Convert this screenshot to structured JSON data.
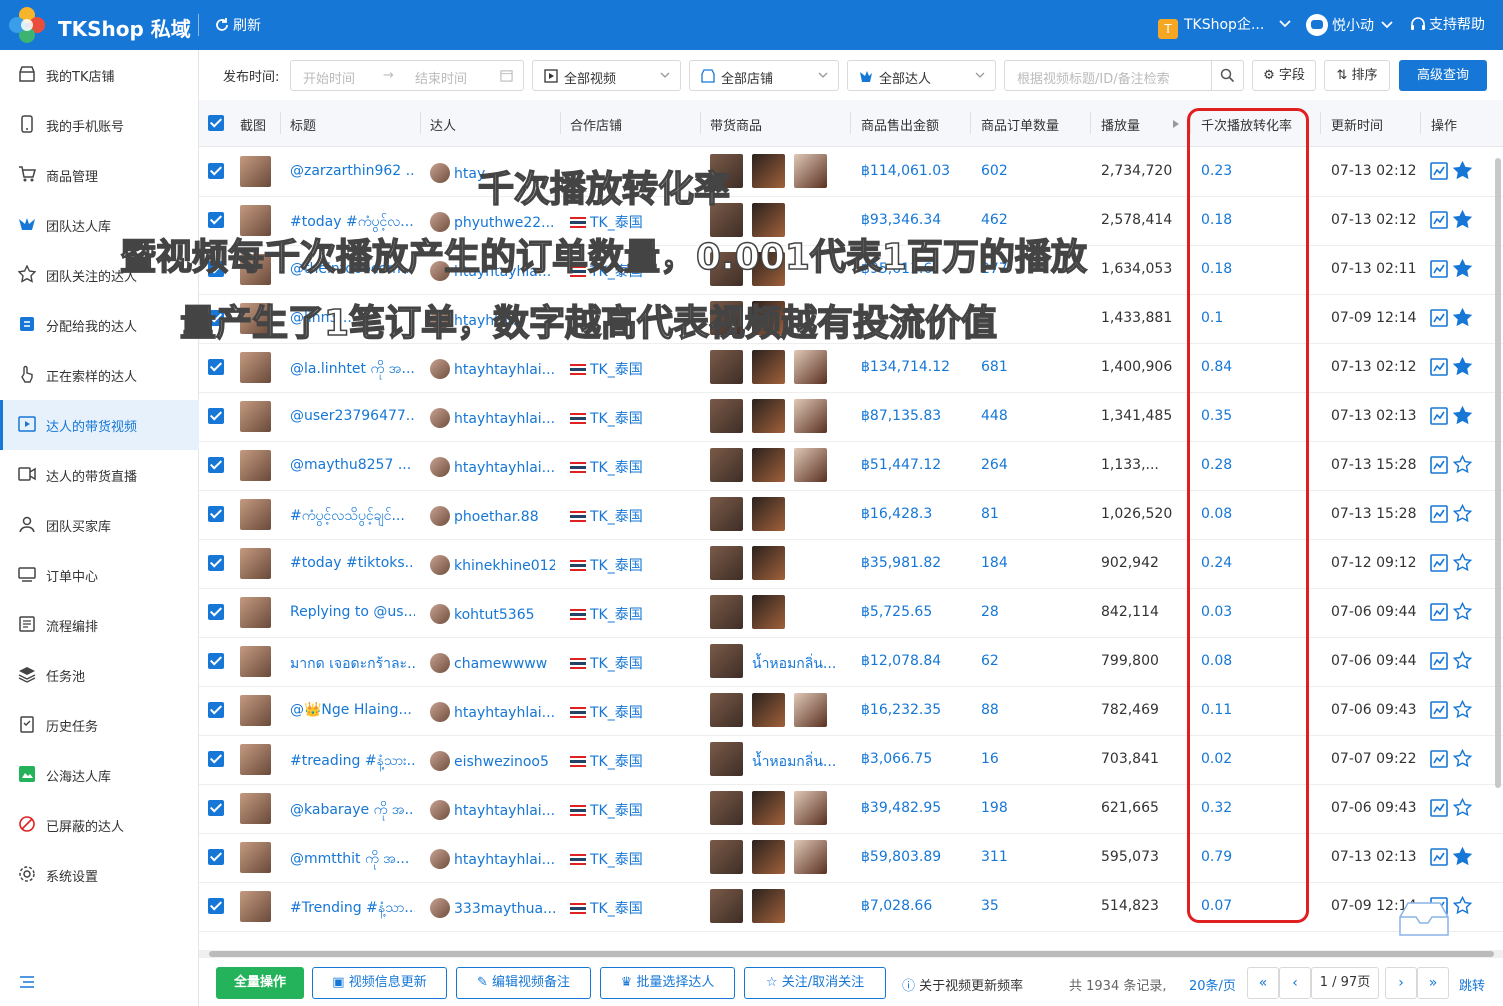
{
  "header": {
    "app_title": "TKShop 私域",
    "refresh": "刷新",
    "company": "TKShop企...",
    "company_badge": "T",
    "user": "悦小动",
    "help": "支持帮助"
  },
  "sidebar": {
    "items": [
      {
        "label": "我的TK店铺",
        "icon": "shop-icon"
      },
      {
        "label": "我的手机账号",
        "icon": "phone-icon"
      },
      {
        "label": "商品管理",
        "icon": "cart-icon"
      },
      {
        "label": "团队达人库",
        "icon": "creator-icon"
      },
      {
        "label": "团队关注的达人",
        "icon": "star-icon"
      },
      {
        "label": "分配给我的达人",
        "icon": "assign-icon"
      },
      {
        "label": "正在索样的达人",
        "icon": "hand-icon"
      },
      {
        "label": "达人的带货视频",
        "icon": "video-icon",
        "active": true
      },
      {
        "label": "达人的带货直播",
        "icon": "live-icon"
      },
      {
        "label": "团队买家库",
        "icon": "buyer-icon"
      },
      {
        "label": "订单中心",
        "icon": "order-icon"
      },
      {
        "label": "流程编排",
        "icon": "flow-icon"
      },
      {
        "label": "任务池",
        "icon": "layers-icon"
      },
      {
        "label": "历史任务",
        "icon": "history-icon"
      },
      {
        "label": "公海达人库",
        "icon": "pool-icon"
      },
      {
        "label": "已屏蔽的达人",
        "icon": "block-icon"
      },
      {
        "label": "系统设置",
        "icon": "gear-icon"
      }
    ]
  },
  "filters": {
    "publish_label": "发布时间:",
    "start_placeholder": "开始时间",
    "end_placeholder": "结束时间",
    "videos": "全部视频",
    "shops": "全部店铺",
    "creators": "全部达人",
    "search_placeholder": "根据视频标题/ID/备注检索",
    "fields": "字段",
    "sort": "排序",
    "advanced": "高级查询"
  },
  "table": {
    "headers": {
      "screenshot": "截图",
      "title": "标题",
      "creator": "达人",
      "shop": "合作店铺",
      "products": "带货商品",
      "gmv": "商品售出金额",
      "orders": "商品订单数量",
      "views": "播放量",
      "cpm_rate": "千次播放转化率",
      "updated": "更新时间",
      "actions": "操作"
    },
    "rows": [
      {
        "title": "@zarzarthin962 ...",
        "creator": "htay...",
        "shop": "",
        "products": [
          "p1",
          "p2",
          "p3"
        ],
        "gmv": "฿114,061.03",
        "orders": "602",
        "views": "2,734,720",
        "rate": "0.23",
        "updated": "07-13 02:12",
        "starred": true
      },
      {
        "title": "#today #ကံပွင့်လ...",
        "creator": "phyuthwe22...",
        "shop": "TK_泰国",
        "products": [
          "p1",
          "p2"
        ],
        "gmv": "฿93,346.34",
        "orders": "462",
        "views": "2,578,414",
        "rate": "0.18",
        "updated": "07-13 02:12",
        "starred": true
      },
      {
        "title": "@theintooocom...",
        "creator": "htayhtayhla...",
        "shop": "TK_泰国",
        "products": [
          "p1",
          "p2"
        ],
        "gmv": "฿95,611.6",
        "orders": "277",
        "views": "1,634,053",
        "rate": "0.18",
        "updated": "07-13 02:11",
        "starred": true
      },
      {
        "title": "@linn3...",
        "creator": "htayhta...",
        "shop": "",
        "products": [
          "p1",
          "p2"
        ],
        "gmv": "",
        "orders": "",
        "views": "1,433,881",
        "rate": "0.1",
        "updated": "07-09 12:14",
        "starred": true
      },
      {
        "title": "@la.linhtet ကို အ...",
        "creator": "htayhtayhlai...",
        "shop": "TK_泰国",
        "products": [
          "p1",
          "p2",
          "p3"
        ],
        "gmv": "฿134,714.12",
        "orders": "681",
        "views": "1,400,906",
        "rate": "0.84",
        "updated": "07-13 02:12",
        "starred": true
      },
      {
        "title": "@user23796477...",
        "creator": "htayhtayhlai...",
        "shop": "TK_泰国",
        "products": [
          "p1",
          "p2",
          "p3"
        ],
        "gmv": "฿87,135.83",
        "orders": "448",
        "views": "1,341,485",
        "rate": "0.35",
        "updated": "07-13 02:13",
        "starred": true
      },
      {
        "title": "@maythu8257 ...",
        "creator": "htayhtayhlai...",
        "shop": "TK_泰国",
        "products": [
          "p1",
          "p2",
          "p3"
        ],
        "gmv": "฿51,447.12",
        "orders": "264",
        "views": "1,133,...",
        "rate": "0.28",
        "updated": "07-13 15:28",
        "starred": false
      },
      {
        "title": "#ကံပွင့်လသိပွင့်ချင်...",
        "creator": "phoethar.88",
        "shop": "TK_泰国",
        "products": [
          "p1",
          "p2"
        ],
        "gmv": "฿16,428.3",
        "orders": "81",
        "views": "1,026,520",
        "rate": "0.08",
        "updated": "07-13 15:28",
        "starred": false
      },
      {
        "title": "#today #tiktoks...",
        "creator": "khinekhine012",
        "shop": "TK_泰国",
        "products": [
          "p1",
          "p2"
        ],
        "gmv": "฿35,981.82",
        "orders": "184",
        "views": "902,942",
        "rate": "0.24",
        "updated": "07-12 09:12",
        "starred": false
      },
      {
        "title": "Replying to @us...",
        "creator": "kohtut5365",
        "shop": "TK_泰国",
        "products": [
          "p1",
          "p2"
        ],
        "gmv": "฿5,725.65",
        "orders": "28",
        "views": "842,114",
        "rate": "0.03",
        "updated": "07-06 09:44",
        "starred": false
      },
      {
        "title": "มากด เจอดะกร้าละ...",
        "creator": "chamewwww",
        "shop": "TK_泰国",
        "products": [
          "p1"
        ],
        "product_text": "น้ำหอมกลิ่น...",
        "gmv": "฿12,078.84",
        "orders": "62",
        "views": "799,800",
        "rate": "0.08",
        "updated": "07-06 09:44",
        "starred": false
      },
      {
        "title": "@👑Nge Hlaing...",
        "creator": "htayhtayhlai...",
        "shop": "TK_泰国",
        "products": [
          "p1",
          "p2",
          "p3"
        ],
        "gmv": "฿16,232.35",
        "orders": "88",
        "views": "782,469",
        "rate": "0.11",
        "updated": "07-06 09:43",
        "starred": false
      },
      {
        "title": "#treading #နံ့သား...",
        "creator": "eishwezinoo5",
        "shop": "TK_泰国",
        "products": [
          "p1"
        ],
        "product_text": "น้ำหอมกลิ่น...",
        "gmv": "฿3,066.75",
        "orders": "16",
        "views": "703,841",
        "rate": "0.02",
        "updated": "07-07 09:22",
        "starred": false
      },
      {
        "title": "@kabaraye ကို အ...",
        "creator": "htayhtayhlai...",
        "shop": "TK_泰国",
        "products": [
          "p1",
          "p2",
          "p3"
        ],
        "gmv": "฿39,482.95",
        "orders": "198",
        "views": "621,665",
        "rate": "0.32",
        "updated": "07-06 09:43",
        "starred": false
      },
      {
        "title": "@mmtthit ကို အ...",
        "creator": "htayhtayhlai...",
        "shop": "TK_泰国",
        "products": [
          "p1",
          "p2",
          "p3"
        ],
        "gmv": "฿59,803.89",
        "orders": "311",
        "views": "595,073",
        "rate": "0.79",
        "updated": "07-13 02:13",
        "starred": true
      },
      {
        "title": "#Trending #နံ့သာ...",
        "creator": "333maythua...",
        "shop": "TK_泰国",
        "products": [
          "p1",
          "p2"
        ],
        "gmv": "฿7,028.66",
        "orders": "35",
        "views": "514,823",
        "rate": "0.07",
        "updated": "07-09 12:14",
        "starred": false
      }
    ]
  },
  "annotations": {
    "line1": "千次播放转化率",
    "line2": "暨视频每千次播放产生的订单数量，0.001代表1百万的播放",
    "line3": "量产生了1笔订单，数字越高代表视频越有投流价值"
  },
  "footer": {
    "all_ops": "全量操作",
    "update_info": "视频信息更新",
    "edit_note": "编辑视频备注",
    "batch_creator": "批量选择达人",
    "follow": "关注/取消关注",
    "about": "关于视频更新频率",
    "total": "共 1934 条记录,",
    "per_page": "20条/页",
    "page": "1 / 97页",
    "jump": "跳转"
  },
  "colors": {
    "primary": "#1677d6",
    "highlight": "#e02020",
    "green": "#24b35b"
  }
}
